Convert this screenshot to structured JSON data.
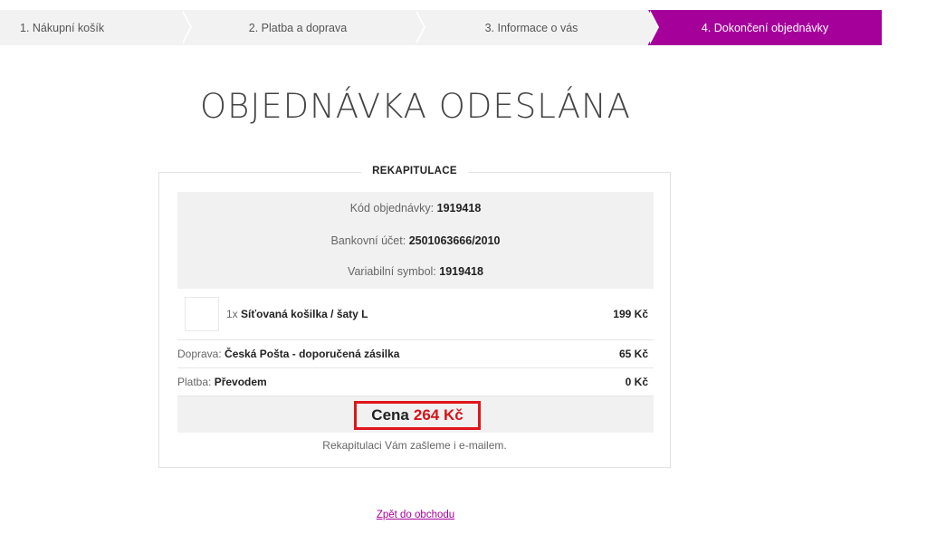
{
  "steps": [
    {
      "label": "1. Nákupní košík"
    },
    {
      "label": "2. Platba a doprava"
    },
    {
      "label": "3. Informace o vás"
    },
    {
      "label": "4. Dokončení objednávky"
    }
  ],
  "title": "OBJEDNÁVKA ODESLÁNA",
  "recap": {
    "legend": "REKAPITULACE",
    "order_code_label": "Kód objednávky:",
    "order_code": "1919418",
    "bank_account_label": "Bankovní účet:",
    "bank_account": "2501063666/2010",
    "variable_symbol_label": "Variabilní symbol:",
    "variable_symbol": "1919418",
    "product": {
      "qty": "1x",
      "name": "Síťovaná košilka / šaty L",
      "price": "199 Kč"
    },
    "shipping": {
      "label": "Doprava:",
      "value": "Česká Pošta - doporučená zásilka",
      "price": "65 Kč"
    },
    "payment": {
      "label": "Platba:",
      "value": "Převodem",
      "price": "0 Kč"
    },
    "total": {
      "label": "Cena",
      "amount": "264 Kč"
    },
    "email_note": "Rekapitulaci Vám zašleme i e-mailem."
  },
  "back_link": "Zpět do obchodu",
  "colors": {
    "accent": "#a5009a",
    "highlight_border": "#e0151b",
    "total_price": "#d4141a"
  }
}
